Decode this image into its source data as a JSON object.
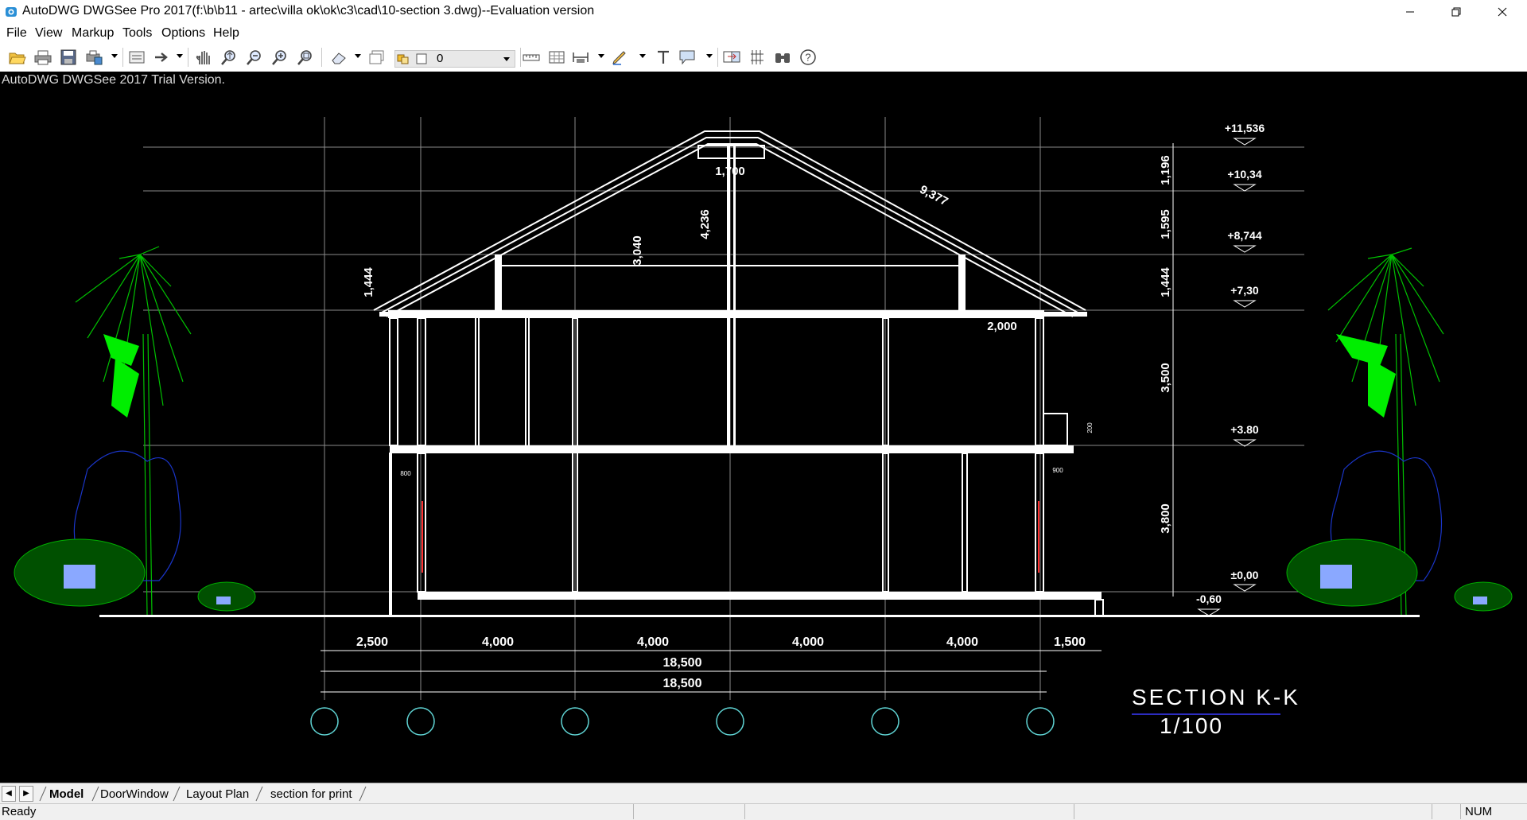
{
  "window": {
    "title": "AutoDWG DWGSee Pro 2017(f:\\b\\b11 - artec\\villa ok\\ok\\c3\\cad\\10-section 3.dwg)--Evaluation version"
  },
  "menu": [
    "File",
    "View",
    "Markup",
    "Tools",
    "Options",
    "Help"
  ],
  "toolbar": {
    "layer_value": "0",
    "icons": [
      "open-icon",
      "print-icon",
      "save-icon",
      "batch-print-icon",
      "page-setup-icon",
      "export-icon",
      "pan-icon",
      "zoom-realtime-icon",
      "zoom-out-icon",
      "zoom-in-icon",
      "zoom-window-icon",
      "eraser-icon",
      "layer-manager-icon",
      "layer-state-icon",
      "measure-distance-icon",
      "measure-area-icon",
      "dimension-icon",
      "pen-markup-icon",
      "text-icon",
      "callout-icon",
      "compare-icon",
      "align-icon",
      "find-icon",
      "help-icon"
    ]
  },
  "canvas": {
    "trial_text": "AutoDWG DWGSee 2017 Trial Version.",
    "background": "#000000",
    "drawing": {
      "elevations": [
        "+11,536",
        "+10,34",
        "+8,744",
        "+7,30",
        "+3.80",
        "±0,00",
        "-0,60"
      ],
      "vertical_dims": [
        "1,196",
        "1,595",
        "1,444",
        "3,500",
        "3,800"
      ],
      "roof_dims": [
        "1,444",
        "3,040",
        "4,236",
        "1,700",
        "9,377",
        "2,000"
      ],
      "small_dims": [
        "800",
        "900",
        "200"
      ],
      "bay_dims": [
        "2,500",
        "4,000",
        "4,000",
        "4,000",
        "4,000",
        "1,500"
      ],
      "total_dims": [
        "18,500",
        "18,500"
      ],
      "section_title": "SECTION K-K",
      "section_scale": "1/100"
    }
  },
  "tabs": [
    "Model",
    "DoorWindow",
    "Layout Plan",
    "section for print"
  ],
  "active_tab": "Model",
  "status": {
    "text": "Ready",
    "num": "NUM"
  },
  "colors": {
    "canvas": "#000000",
    "cad_white": "#ffffff",
    "tree_green": "#00ff00",
    "shrub_blue": "#1a35c8",
    "grid_axis": "#5fd3d3",
    "section_underline": "#3a3aff"
  }
}
